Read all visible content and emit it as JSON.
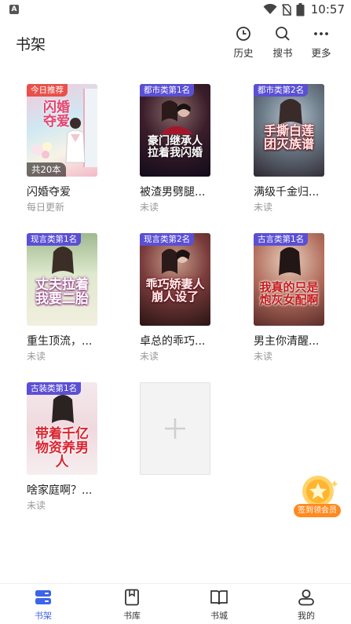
{
  "status_bar": {
    "time": "10:57",
    "battery": "5"
  },
  "header": {
    "title": "书架",
    "actions": [
      {
        "label": "历史",
        "icon": "history-clock-icon"
      },
      {
        "label": "搜书",
        "icon": "search-icon"
      },
      {
        "label": "更多",
        "icon": "more-dots-icon"
      }
    ]
  },
  "books": [
    {
      "badge": "今日推荐",
      "count": "共20本",
      "cover_text": "闪婚夺爱",
      "title": "闪婚夺爱",
      "sub": "每日更新"
    },
    {
      "badge": "都市类第1名",
      "cover_text": "豪门继承人 拉着我闪婚",
      "title": "被渣男劈腿...",
      "sub": "未读"
    },
    {
      "badge": "都市类第2名",
      "cover_text": "手撕白莲 团灭族谱",
      "title": "满级千金归...",
      "sub": "未读"
    },
    {
      "badge": "现言类第1名",
      "cover_text": "丈夫拉着 我要二胎",
      "title": "重生顶流，...",
      "sub": "未读"
    },
    {
      "badge": "现言类第2名",
      "cover_text": "乖巧娇妻人 崩人设了",
      "title": "卓总的乖巧...",
      "sub": "未读"
    },
    {
      "badge": "古言类第1名",
      "cover_text": "我真的只是 炮灰女配啊",
      "title": "男主你清醒...",
      "sub": "未读"
    },
    {
      "badge": "古装类第1名",
      "cover_text": "带着千亿 物资养男人",
      "title": "啥家庭啊？...",
      "sub": "未读"
    }
  ],
  "promo": {
    "label": "签到领会员"
  },
  "bottom_nav": [
    {
      "label": "书架",
      "icon": "bookshelf-icon",
      "active": true
    },
    {
      "label": "书库",
      "icon": "library-icon"
    },
    {
      "label": "书城",
      "icon": "bookstore-icon"
    },
    {
      "label": "我的",
      "icon": "profile-icon"
    }
  ],
  "colors": {
    "accent": "#3d63e8",
    "badge_purple": "#5b4fd4",
    "badge_red": "#e8514b",
    "promo_orange": "#ff8a1f"
  }
}
